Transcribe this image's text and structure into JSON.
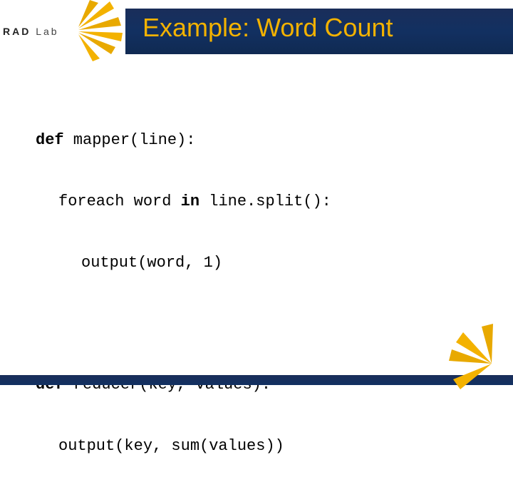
{
  "logo": {
    "text_left": "RAD",
    "text_right": "Lab"
  },
  "title": "Example: Word Count",
  "code": {
    "block1": {
      "l1a": "def",
      "l1b": " mapper(line):",
      "l2a": "foreach word ",
      "l2b": "in",
      "l2c": " line.split():",
      "l3": "output(word, 1)"
    },
    "block2": {
      "l1a": "def",
      "l1b": " reducer(key, values):",
      "l2": "output(key, sum(values))"
    }
  }
}
